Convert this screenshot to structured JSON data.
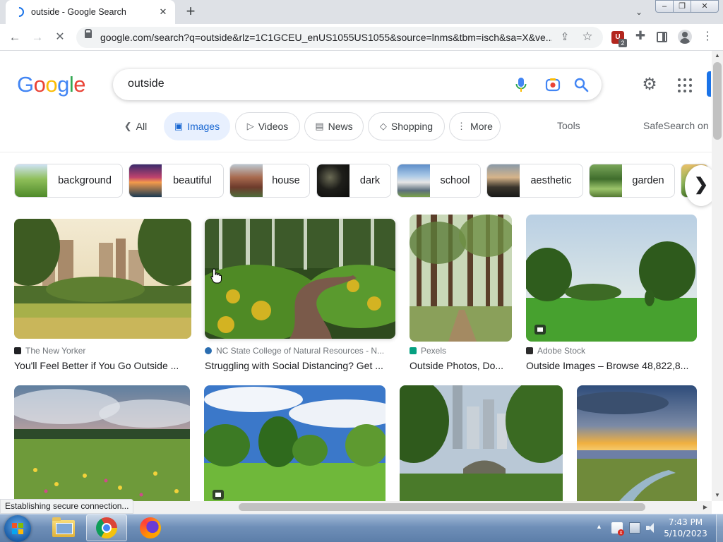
{
  "browser": {
    "tab_title": "outside - Google Search",
    "tab_close": "✕",
    "new_tab": "+",
    "url": "google.com/search?q=outside&rlz=1C1GCEU_enUS1055US1055&source=lnms&tbm=isch&sa=X&ve...",
    "extension_badge": "2",
    "status": "Establishing secure connection..."
  },
  "google": {
    "logo_letters": [
      "G",
      "o",
      "o",
      "g",
      "l",
      "e"
    ],
    "query": "outside",
    "filters": [
      {
        "label": "All",
        "icon": "chevron-left-icon"
      },
      {
        "label": "Images",
        "icon": "image-icon"
      },
      {
        "label": "Videos",
        "icon": "play-icon"
      },
      {
        "label": "News",
        "icon": "news-icon"
      },
      {
        "label": "Shopping",
        "icon": "tag-icon"
      },
      {
        "label": "More",
        "icon": "more-vert-icon"
      }
    ],
    "tools": "Tools",
    "safesearch": "SafeSearch on"
  },
  "related": [
    {
      "label": "background"
    },
    {
      "label": "beautiful"
    },
    {
      "label": "house"
    },
    {
      "label": "dark"
    },
    {
      "label": "school"
    },
    {
      "label": "aesthetic"
    },
    {
      "label": "garden"
    }
  ],
  "results": [
    {
      "source": "The New Yorker",
      "caption": "You'll Feel Better if You Go Outside ..."
    },
    {
      "source": "NC State College of Natural Resources - N...",
      "caption": "Struggling with Social Distancing? Get ..."
    },
    {
      "source": "Pexels",
      "caption": "Outside Photos, Do..."
    },
    {
      "source": "Adobe Stock",
      "caption": "Outside Images – Browse 48,822,8..."
    }
  ],
  "taskbar": {
    "time": "7:43 PM",
    "date": "5/10/2023"
  },
  "colors": {
    "accent": "#1a73e8",
    "chip_selected_bg": "#e8f0fe",
    "chip_selected_text": "#1967d2"
  }
}
